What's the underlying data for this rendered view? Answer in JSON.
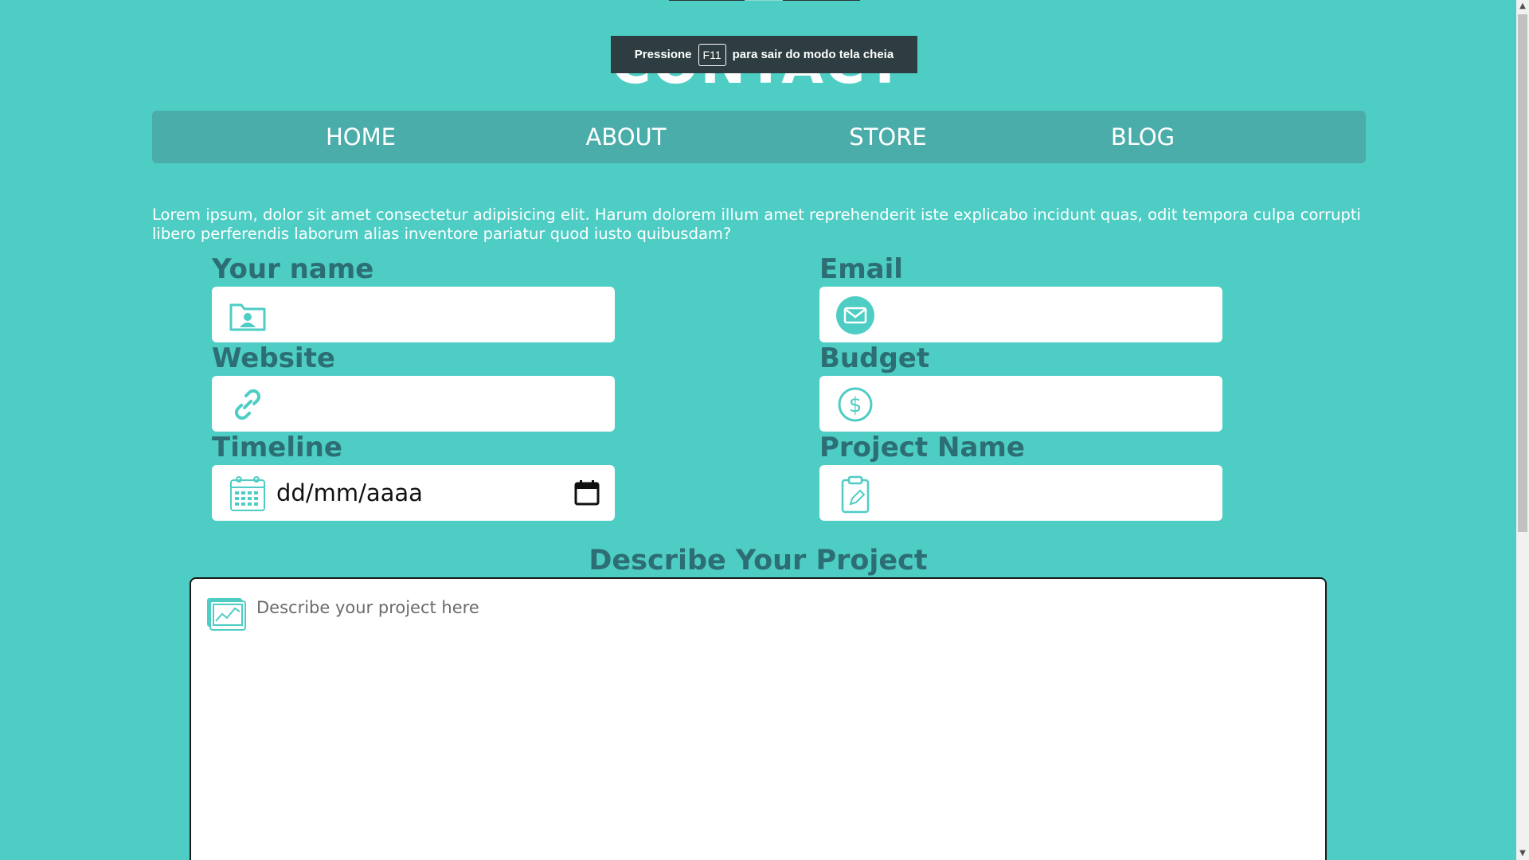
{
  "header": {
    "title": "CONTACT"
  },
  "fullscreen_notice": {
    "prefix": "Pressione",
    "key": "F11",
    "suffix": "para sair do modo tela cheia"
  },
  "nav": {
    "items": [
      {
        "label": "HOME"
      },
      {
        "label": "ABOUT"
      },
      {
        "label": "STORE"
      },
      {
        "label": "BLOG"
      }
    ]
  },
  "intro": {
    "text": "Lorem ipsum, dolor sit amet consectetur adipisicing elit. Harum dolorem illum amet reprehenderit iste explicabo incidunt quas, odit tempora culpa corrupti libero perferendis laborum alias inventore pariatur quod iusto quibusdam?"
  },
  "form": {
    "name": {
      "label": "Your name",
      "icon": "contact-folder-icon"
    },
    "email": {
      "label": "Email",
      "icon": "envelope-icon"
    },
    "website": {
      "label": "Website",
      "icon": "link-icon"
    },
    "budget": {
      "label": "Budget",
      "icon": "dollar-icon"
    },
    "timeline": {
      "label": "Timeline",
      "value": "dd/mm/aaaa",
      "icon": "calendar-icon"
    },
    "project_name": {
      "label": "Project Name",
      "icon": "clipboard-icon"
    },
    "describe": {
      "label": "Describe Your Project",
      "placeholder": "Describe your project here",
      "icon": "chart-report-icon"
    }
  },
  "colors": {
    "background": "#4ecdc4",
    "nav_bar": "#4aadaa",
    "label": "#2c6e73",
    "icon": "#4ecdc4"
  }
}
